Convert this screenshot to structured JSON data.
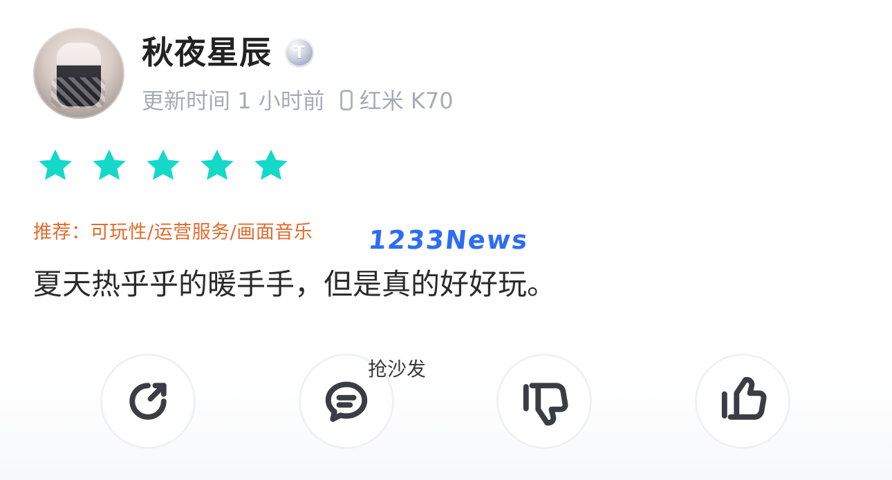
{
  "user": {
    "name": "秋夜星辰",
    "badge": "T"
  },
  "meta": {
    "update_time": "更新时间 1 小时前",
    "device": "红米 K70"
  },
  "rating": {
    "stars": 5,
    "max": 5,
    "color": "#14d9c9"
  },
  "recommend": {
    "text": "推荐：可玩性/运营服务/画面音乐",
    "color": "#e06b2d"
  },
  "watermark": {
    "text": "1233News",
    "color": "#2d6df6"
  },
  "review": {
    "text": "夏天热乎乎的暖手手，但是真的好好玩。"
  },
  "actions": {
    "share_icon": "share-icon",
    "comment_icon": "comment-icon",
    "dislike_icon": "thumbs-down-icon",
    "like_icon": "thumbs-up-icon",
    "comment_hint": "抢沙发"
  }
}
